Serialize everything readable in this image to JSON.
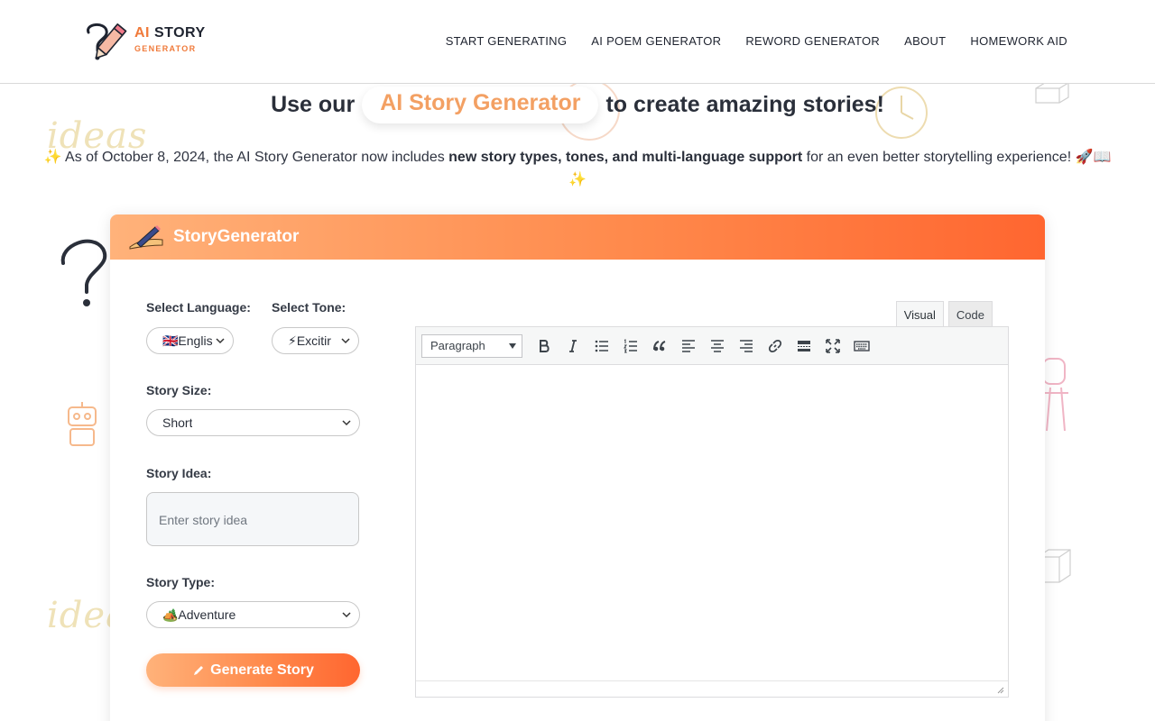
{
  "logo": {
    "title_ai": "AI",
    "title_rest": " STORY",
    "subtitle": "GENERATOR"
  },
  "nav": [
    {
      "label": "START GENERATING"
    },
    {
      "label": "AI POEM GENERATOR"
    },
    {
      "label": "REWORD GENERATOR"
    },
    {
      "label": "ABOUT"
    },
    {
      "label": "HOMEWORK AID"
    }
  ],
  "hero": {
    "prefix": "Use our",
    "highlight": "AI Story Generator",
    "suffix": "to create amazing stories!"
  },
  "notice": {
    "lead_emoji": "✨",
    "part1": " As of October 8, 2024, the AI Story Generator now includes ",
    "bold": "new story types, tones, and multi-language support",
    "part2": " for an even better storytelling experience! ",
    "trail_emoji": "🚀📖✨"
  },
  "decor": {
    "ideas_word": "ideas"
  },
  "card": {
    "title": "StoryGenerator"
  },
  "form": {
    "language_label": "Select Language:",
    "language_value": "🇬🇧Englis",
    "tone_label": "Select Tone:",
    "tone_value": "⚡Excitir",
    "size_label": "Story Size:",
    "size_value": "Short",
    "idea_label": "Story Idea:",
    "idea_placeholder": "Enter story idea",
    "type_label": "Story Type:",
    "type_value": "🏕️Adventure",
    "generate_label": "Generate Story"
  },
  "editor": {
    "tab_visual": "Visual",
    "tab_code": "Code",
    "format_value": "Paragraph"
  },
  "colors": {
    "accent": "#ff7a3d",
    "accent_light": "#ffb27a",
    "highlight_text": "#f3a063"
  }
}
